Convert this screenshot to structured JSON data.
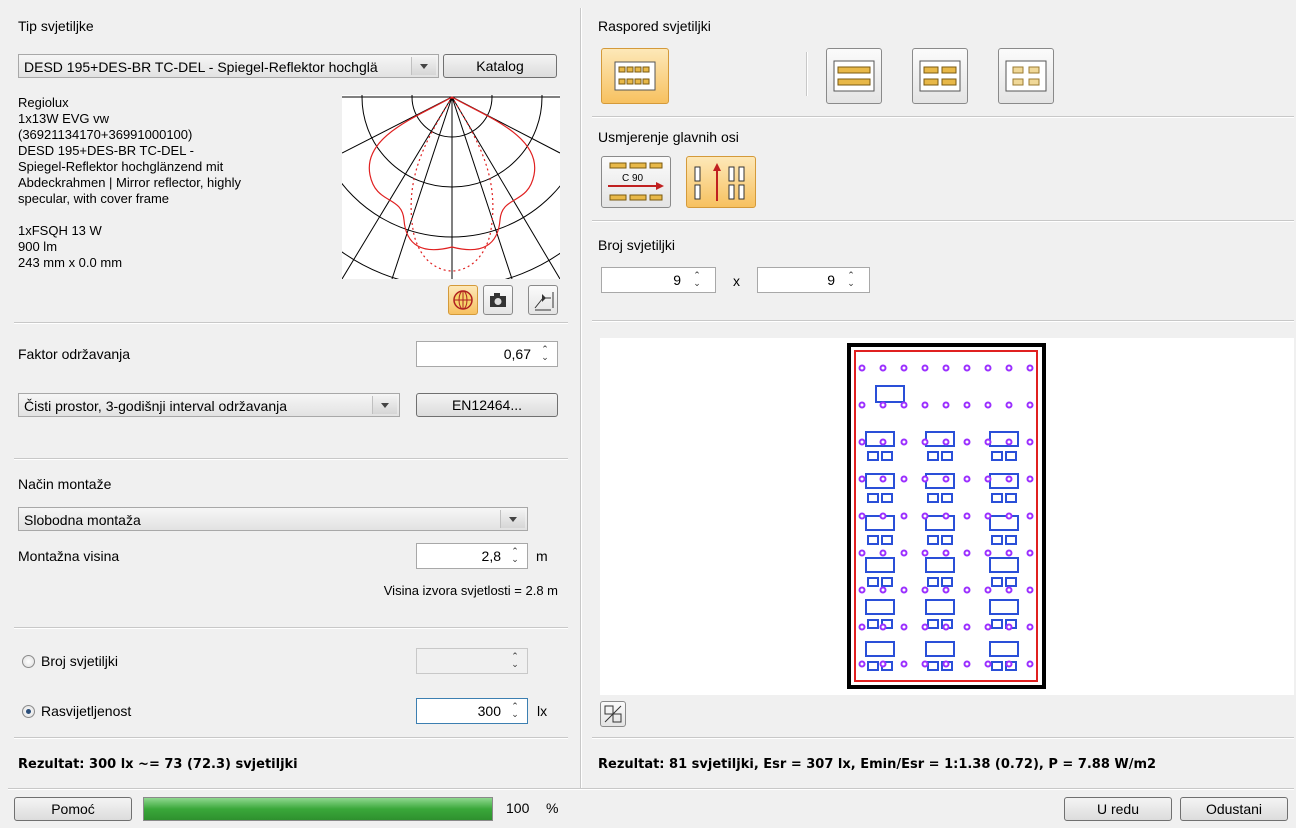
{
  "left": {
    "luminaire_type_label": "Tip svjetiljke",
    "luminaire_select_value": "DESD 195+DES-BR TC-DEL - Spiegel-Reflektor hochglä",
    "catalog_button": "Katalog",
    "description": "Regiolux\n1x13W EVG vw\n(36921134170+36991000100)\nDESD 195+DES-BR TC-DEL -\nSpiegel-Reflektor hochglänzend mit\nAbdeckrahmen | Mirror reflector, highly\nspecular, with cover frame\n\n1xFSQH 13 W\n900 lm\n243 mm x 0.0 mm",
    "maintenance_factor_label": "Faktor održavanja",
    "maintenance_factor_value": "0,67",
    "maintenance_select_value": "Čisti prostor, 3-godišnji interval održavanja",
    "en_button": "EN12464...",
    "mounting_label": "Način montaže",
    "mounting_select_value": "Slobodna montaža",
    "mounting_height_label": "Montažna visina",
    "mounting_height_value": "2,8",
    "mounting_height_unit": "m",
    "light_source_height": "Visina izvora svjetlosti = 2.8 m",
    "radio_count_label": "Broj svjetiljki",
    "radio_illuminance_label": "Rasvijetljenost",
    "illuminance_value": "300",
    "illuminance_unit": "lx",
    "result": "Rezultat: 300 lx ~= 73 (72.3) svjetiljki"
  },
  "right": {
    "arrangement_label": "Raspored svjetiljki",
    "axis_label": "Usmjerenje glavnih osi",
    "axis_c90": "C 90",
    "count_label": "Broj svjetiljki",
    "count_x": "9",
    "times": "x",
    "count_y": "9",
    "result": "Rezultat: 81 svjetiljki, Esr = 307 lx, Emin/Esr = 1:1.38 (0.72), P = 7.88 W/m2"
  },
  "footer": {
    "help_button": "Pomoć",
    "progress_percent": 100,
    "progress_value": "100",
    "progress_unit": "%",
    "ok_button": "U redu",
    "cancel_button": "Odustani"
  },
  "colors": {
    "accent_active": "#f7c160",
    "progress": "#3aa83a",
    "room_outline": "#e02020",
    "luminaire": "#9b30ff",
    "furniture": "#2a4fd8"
  }
}
